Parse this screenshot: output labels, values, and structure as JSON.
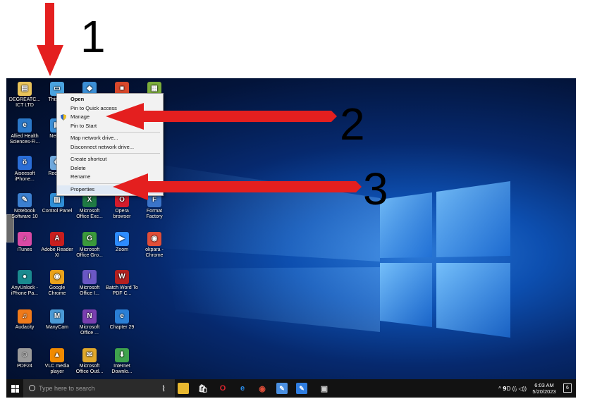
{
  "annotations": {
    "step1": "1",
    "step2": "2",
    "step3": "3"
  },
  "desktop_icons": [
    {
      "label": "DEGREATC... ICT LTD",
      "icon": "folder-icon",
      "color": "#e8c35a"
    },
    {
      "label": "This PC",
      "icon": "computer-icon",
      "color": "#4aa3df"
    },
    {
      "label": "",
      "icon": "app-icon",
      "color": "#3c8fd6"
    },
    {
      "label": "",
      "icon": "app-icon",
      "color": "#d9482b"
    },
    {
      "label": "",
      "icon": "app-icon",
      "color": "#7cae3b"
    },
    {
      "label": "Allied Health Sciences-Fi...",
      "icon": "pdf-icon",
      "color": "#2b78c8"
    },
    {
      "label": "Netw...",
      "icon": "network-icon",
      "color": "#3a8ed6"
    },
    {
      "label": "Aiseesoft iPhone...",
      "icon": "app-icon",
      "color": "#2a6dd6"
    },
    {
      "label": "Recyc...",
      "icon": "recycle-bin-icon",
      "color": "#6fa8dc"
    },
    {
      "label": "Notebook Software 10",
      "icon": "app-icon",
      "color": "#3b7fd0"
    },
    {
      "label": "Control Panel",
      "icon": "control-panel-icon",
      "color": "#2f8fd8"
    },
    {
      "label": "Microsoft Office Exc...",
      "icon": "excel-icon",
      "color": "#1f7a44"
    },
    {
      "label": "Opera browser",
      "icon": "opera-icon",
      "color": "#d41b2c"
    },
    {
      "label": "Format Factory",
      "icon": "app-icon",
      "color": "#3a74c9"
    },
    {
      "label": "iTunes",
      "icon": "itunes-icon",
      "color": "#d94aa5"
    },
    {
      "label": "Adobe Reader XI",
      "icon": "adobe-reader-icon",
      "color": "#c81e1e"
    },
    {
      "label": "Microsoft Office Gro...",
      "icon": "groove-icon",
      "color": "#3b9a3b"
    },
    {
      "label": "Zoom",
      "icon": "zoom-icon",
      "color": "#2d8cff"
    },
    {
      "label": "okpara - Chrome",
      "icon": "chrome-icon",
      "color": "#e04e39"
    },
    {
      "label": "AnyUnlock - iPhone Pa...",
      "icon": "app-icon",
      "color": "#1a8a8f"
    },
    {
      "label": "Google Chrome",
      "icon": "chrome-icon",
      "color": "#e9a21b"
    },
    {
      "label": "Microsoft Office I...",
      "icon": "infopath-icon",
      "color": "#6a57c4"
    },
    {
      "label": "Batch Word To PDF C...",
      "icon": "app-icon",
      "color": "#b32020"
    },
    {
      "label": "Audacity",
      "icon": "audacity-icon",
      "color": "#f07a1a"
    },
    {
      "label": "ManyCam",
      "icon": "manycam-icon",
      "color": "#4a9ad6"
    },
    {
      "label": "Microsoft Office ...",
      "icon": "onenote-icon",
      "color": "#7a3fb0"
    },
    {
      "label": "Chapter 29",
      "icon": "edge-file-icon",
      "color": "#2a7fd6"
    },
    {
      "label": "PDF24",
      "icon": "pdf24-icon",
      "color": "#9a9a9a"
    },
    {
      "label": "VLC media player",
      "icon": "vlc-icon",
      "color": "#f08a00"
    },
    {
      "label": "Microsoft Office Outl...",
      "icon": "outlook-icon",
      "color": "#e0a82b"
    },
    {
      "label": "Internet Downlo...",
      "icon": "idm-icon",
      "color": "#3fa34d"
    }
  ],
  "context_menu": {
    "open": "Open",
    "pin_quick": "Pin to Quick access",
    "manage": "Manage",
    "pin_start": "Pin to Start",
    "map_drive": "Map network drive...",
    "disconnect_drive": "Disconnect network drive...",
    "create_shortcut": "Create shortcut",
    "delete": "Delete",
    "rename": "Rename",
    "properties": "Properties"
  },
  "taskbar": {
    "search_placeholder": "Type here to search",
    "apps": [
      {
        "icon": "microphone-icon",
        "color": "#cfcfcf"
      },
      {
        "icon": "file-explorer-icon",
        "color": "#e8b830"
      },
      {
        "icon": "store-icon",
        "color": "#ffffff"
      },
      {
        "icon": "opera-icon",
        "color": "#e0262f"
      },
      {
        "icon": "edge-icon",
        "color": "#2a8ce8"
      },
      {
        "icon": "chrome-icon",
        "color": "#e04e39"
      },
      {
        "icon": "notebook-icon",
        "color": "#4a8fe0"
      },
      {
        "icon": "notebook-icon",
        "color": "#2f7de0"
      },
      {
        "icon": "camera-icon",
        "color": "#cfcfcf"
      }
    ],
    "tray_glyphs": "^ 𝟵D ((ᵢ ◁))",
    "time": "6:03 AM",
    "date": "5/20/2023",
    "notifications": "6"
  }
}
